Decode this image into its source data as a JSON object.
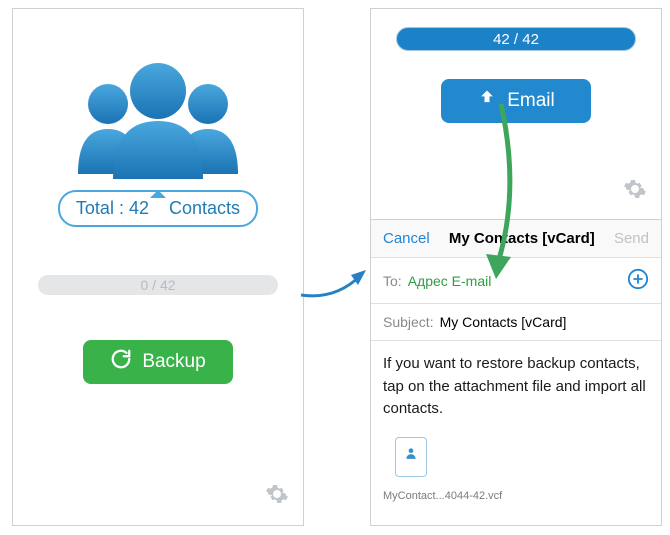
{
  "left": {
    "total_prefix": "Total :",
    "total_count": "42",
    "total_suffix": "Contacts",
    "progress_label": "0 / 42",
    "backup_label": "Backup"
  },
  "right": {
    "progress_label": "42 / 42",
    "email_label": "Email",
    "sheet": {
      "cancel": "Cancel",
      "title": "My Contacts [vCard]",
      "send": "Send",
      "to_label": "To:",
      "to_value": "Адрес E-mail",
      "subject_label": "Subject:",
      "subject_value": "My Contacts [vCard]",
      "body": "If you want to restore backup contacts, tap on the attachment file and import all contacts.",
      "attachment_name": "MyContact...4044-42.vcf"
    }
  }
}
